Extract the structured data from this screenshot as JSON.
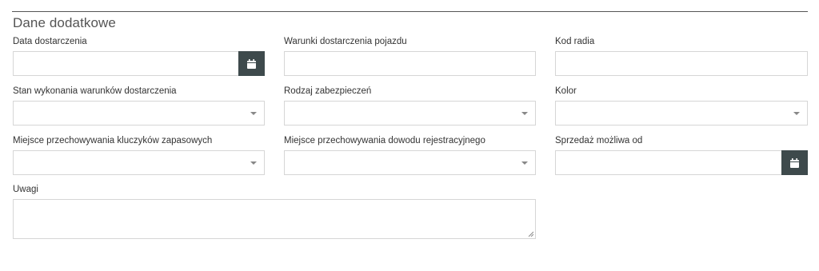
{
  "section": {
    "title": "Dane dodatkowe"
  },
  "fields": {
    "delivery_date": {
      "label": "Data dostarczenia",
      "value": ""
    },
    "delivery_conditions": {
      "label": "Warunki dostarczenia pojazdu",
      "value": ""
    },
    "radio_code": {
      "label": "Kod radia",
      "value": ""
    },
    "conditions_status": {
      "label": "Stan wykonania warunków dostarczenia",
      "value": ""
    },
    "security_type": {
      "label": "Rodzaj zabezpieczeń",
      "value": ""
    },
    "color": {
      "label": "Kolor",
      "value": ""
    },
    "spare_keys_location": {
      "label": "Miejsce przechowywania kluczyków zapasowych",
      "value": ""
    },
    "registration_doc_location": {
      "label": "Miejsce przechowywania dowodu rejestracyjnego",
      "value": ""
    },
    "sale_possible_from": {
      "label": "Sprzedaż możliwa od",
      "value": ""
    },
    "notes": {
      "label": "Uwagi",
      "value": ""
    }
  },
  "icons": {
    "date_picker": "calendar-icon",
    "select": "caret-down-icon",
    "textarea": "resize-grip-icon"
  },
  "colors": {
    "date_button_bg": "#3e4a4c",
    "input_border": "#d6d6d6",
    "caret": "#888888"
  }
}
